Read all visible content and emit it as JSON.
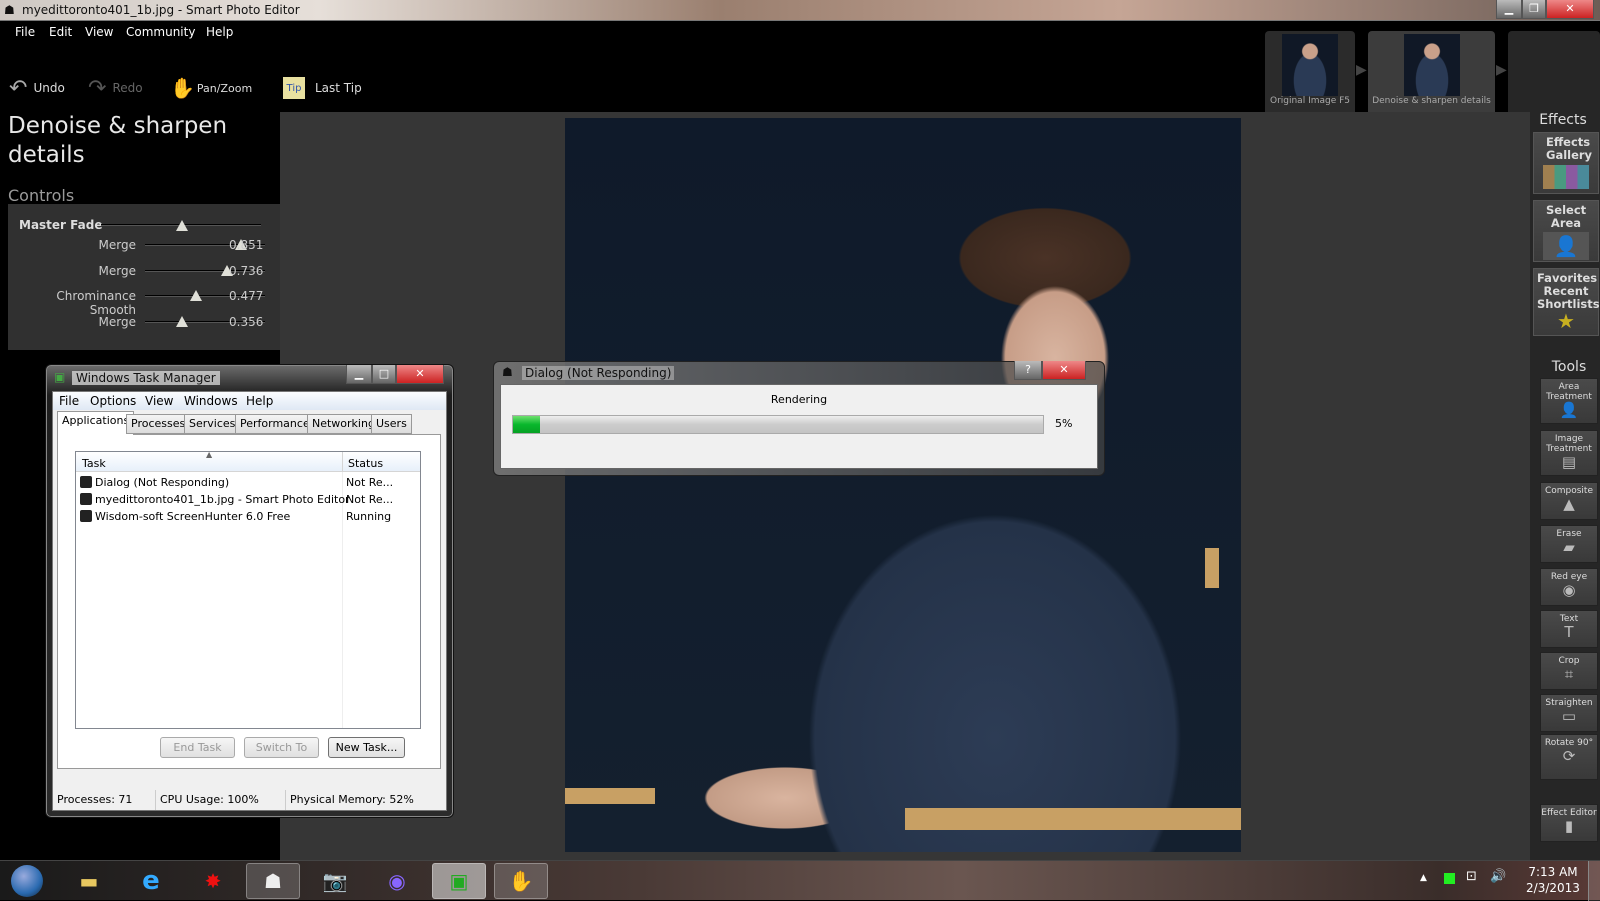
{
  "window": {
    "title": "myedittoronto401_1b.jpg - Smart Photo Editor",
    "minimize": "▁",
    "restore": "❐",
    "close": "✕"
  },
  "menu": [
    "File",
    "Edit",
    "View",
    "Community",
    "Help"
  ],
  "toolbar": {
    "undo": "Undo",
    "redo": "Redo",
    "pan_zoom": "Pan/Zoom",
    "last_tip": "Last Tip",
    "tip_icon": "Tip"
  },
  "history": [
    {
      "label": "Original Image F5"
    },
    {
      "label": "Denoise & sharpen details"
    }
  ],
  "effect": {
    "title": "Denoise & sharpen details",
    "controls_label": "Controls",
    "master": {
      "label": "Master Fade",
      "value": 0.5
    },
    "sliders": [
      {
        "label": "Merge",
        "value": 0.851
      },
      {
        "label": "Merge",
        "value": 0.736
      },
      {
        "label": "Chrominance Smooth",
        "value": 0.477
      },
      {
        "label": "Merge",
        "value": 0.356
      }
    ]
  },
  "effects_panel": {
    "header": "Effects",
    "buttons": [
      "Effects Gallery",
      "Select Area",
      "Favorites Recent Shortlists"
    ]
  },
  "tools_panel": {
    "header": "Tools",
    "buttons": [
      {
        "label": "Area Treatment",
        "icon": "person-silhouette-icon",
        "glyph": "👤"
      },
      {
        "label": "Image Treatment",
        "icon": "gradient-icon",
        "glyph": "▤"
      },
      {
        "label": "Composite",
        "icon": "mountain-icon",
        "glyph": "▲"
      },
      {
        "label": "Erase",
        "icon": "eraser-icon",
        "glyph": "▰"
      },
      {
        "label": "Red eye",
        "icon": "eye-icon",
        "glyph": "◉"
      },
      {
        "label": "Text",
        "icon": "text-icon",
        "glyph": "T"
      },
      {
        "label": "Crop",
        "icon": "crop-icon",
        "glyph": "⌗"
      },
      {
        "label": "Straighten",
        "icon": "level-icon",
        "glyph": "▭"
      },
      {
        "label": "Rotate 90°",
        "icon": "rotate-icon",
        "glyph": "⟳"
      },
      {
        "label": "Effect Editor",
        "icon": "slider-icon",
        "glyph": "▮"
      }
    ]
  },
  "task_manager": {
    "title": "Windows Task Manager",
    "menu": [
      "File",
      "Options",
      "View",
      "Windows",
      "Help"
    ],
    "tabs": [
      "Applications",
      "Processes",
      "Services",
      "Performance",
      "Networking",
      "Users"
    ],
    "columns": [
      "Task",
      "Status"
    ],
    "rows": [
      {
        "task": "Dialog (Not Responding)",
        "status": "Not Re..."
      },
      {
        "task": "myedittoronto401_1b.jpg - Smart Photo Editor",
        "status": "Not Re..."
      },
      {
        "task": "Wisdom-soft ScreenHunter 6.0 Free",
        "status": "Running"
      }
    ],
    "buttons": {
      "end_task": "End Task",
      "switch_to": "Switch To",
      "new_task": "New Task..."
    },
    "status": {
      "processes": "Processes: 71",
      "cpu": "CPU Usage: 100%",
      "memory": "Physical Memory: 52%"
    }
  },
  "dialog": {
    "title": "Dialog (Not Responding)",
    "message": "Rendering",
    "progress": 5,
    "progress_label": "5%",
    "help": "?",
    "close": "✕"
  },
  "taskbar": {
    "clock_time": "7:13 AM",
    "clock_date": "2/3/2013",
    "colors": {
      "progress": "#08b82c"
    }
  }
}
